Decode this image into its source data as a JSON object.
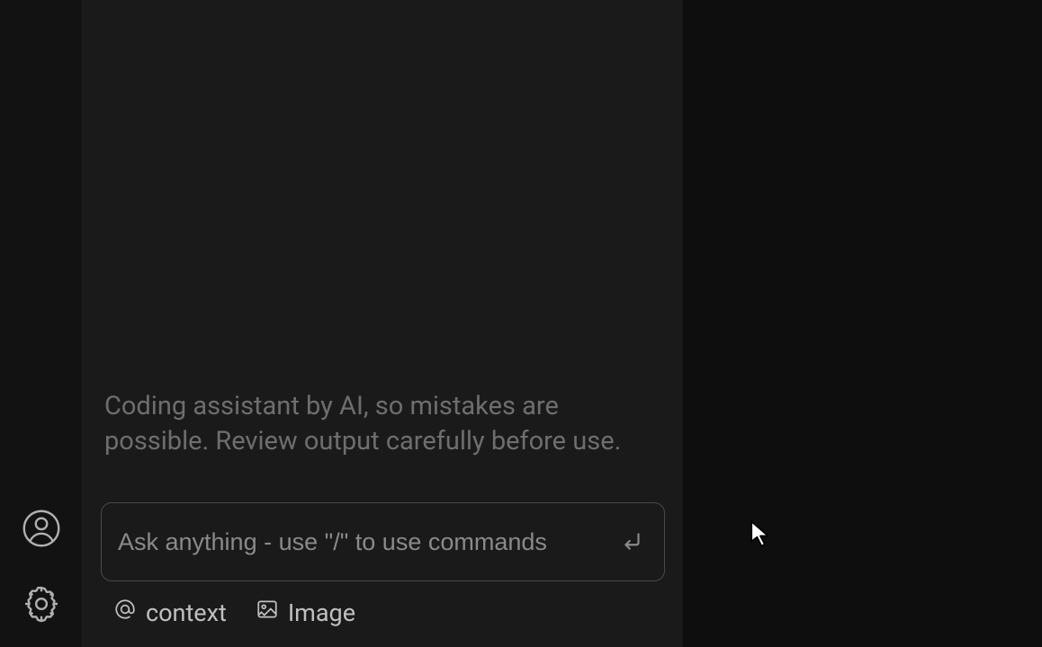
{
  "sidebar": {
    "account_label": "account",
    "settings_label": "settings"
  },
  "main": {
    "disclaimer_text": "Coding assistant by AI, so mistakes are possible. Review output carefully before use.",
    "input": {
      "placeholder": "Ask anything - use \"/\" to use commands",
      "value": ""
    },
    "actions": {
      "context_label": "context",
      "image_label": "Image"
    }
  }
}
